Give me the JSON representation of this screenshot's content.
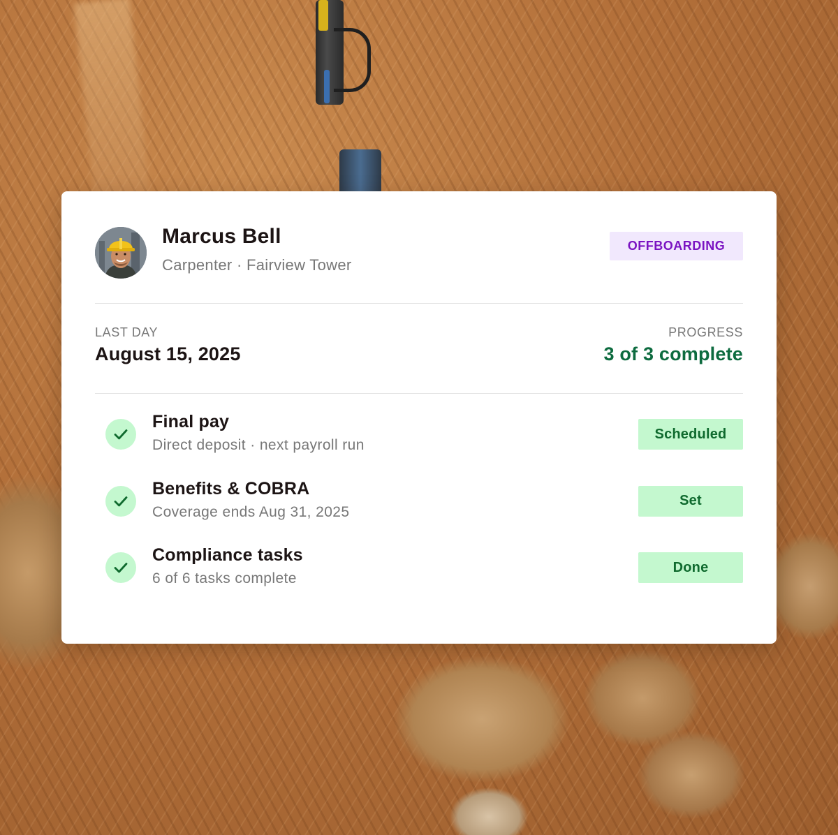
{
  "employee": {
    "name": "Marcus Bell",
    "role_location": "Carpenter · Fairview Tower",
    "status_badge": "OFFBOARDING"
  },
  "summary": {
    "last_day_label": "LAST DAY",
    "last_day_value": "August 15, 2025",
    "progress_label": "PROGRESS",
    "progress_value": "3 of 3 complete"
  },
  "tasks": [
    {
      "title": "Final pay",
      "subtitle": "Direct deposit · next payroll run",
      "status": "Scheduled",
      "icon": "check-icon"
    },
    {
      "title": "Benefits & COBRA",
      "subtitle": "Coverage ends Aug 31, 2025",
      "status": "Set",
      "icon": "check-icon"
    },
    {
      "title": "Compliance tasks",
      "subtitle": "6 of 6 tasks complete",
      "status": "Done",
      "icon": "check-icon"
    }
  ],
  "colors": {
    "badge_bg": "#f1e8fd",
    "badge_text": "#7b14c2",
    "success_bg": "#c4f8cf",
    "success_text": "#0f6a2e",
    "progress_text": "#0d6b3f"
  }
}
